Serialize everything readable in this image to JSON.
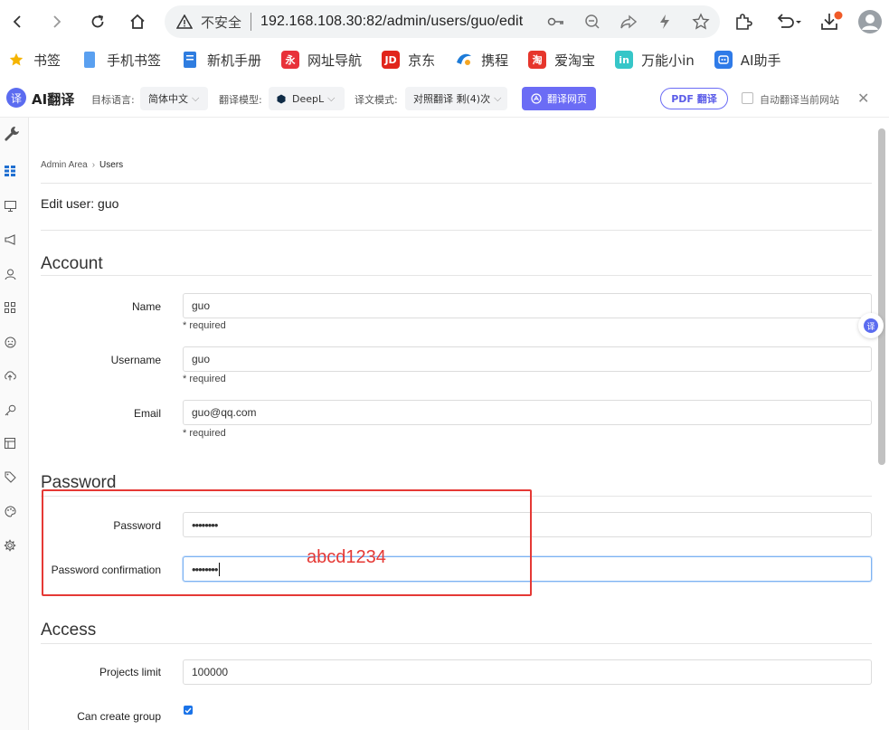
{
  "browser": {
    "insecure_label": "不安全",
    "url": "192.168.108.30:82/admin/users/guo/edit"
  },
  "bookmarks": [
    {
      "label": "书签",
      "icon": "star-icon",
      "color": "#f5b400"
    },
    {
      "label": "手机书签",
      "icon": "phone-icon",
      "color": "#5aa0f0"
    },
    {
      "label": "新机手册",
      "icon": "book-icon",
      "color": "#2f7de0"
    },
    {
      "label": "网址导航",
      "icon": "nav-icon",
      "color": "#e8323a"
    },
    {
      "label": "京东",
      "icon": "jd-icon",
      "color": "#e1251b"
    },
    {
      "label": "携程",
      "icon": "ctrip-icon",
      "color": "#1d7bd8"
    },
    {
      "label": "爱淘宝",
      "icon": "taobao-icon",
      "color": "#e6362c"
    },
    {
      "label": "万能小in",
      "icon": "in-icon",
      "color": "#36c6c8"
    },
    {
      "label": "AI助手",
      "icon": "ai-icon",
      "color": "#2f7be8"
    }
  ],
  "translate_bar": {
    "logo_char": "译",
    "title": "AI翻译",
    "target_lang_label": "目标语言:",
    "target_lang_value": "简体中文",
    "model_label": "翻译模型:",
    "model_value": "DeepL",
    "mode_label": "译文模式:",
    "mode_value": "对照翻译 剩(4)次",
    "translate_button": "翻译网页",
    "pdf_button": "PDF 翻译",
    "auto_label": "自动翻译当前网站"
  },
  "breadcrumb": {
    "root": "Admin Area",
    "current": "Users"
  },
  "page_title": "Edit user: guo",
  "sections": {
    "account": "Account",
    "password": "Password",
    "access": "Access"
  },
  "fields": {
    "name": {
      "label": "Name",
      "value": "guo",
      "hint": "* required"
    },
    "username": {
      "label": "Username",
      "value": "guo",
      "hint": "* required"
    },
    "email": {
      "label": "Email",
      "value": "guo@qq.com",
      "hint": "* required"
    },
    "password": {
      "label": "Password",
      "value": "••••••••"
    },
    "password_confirmation": {
      "label": "Password confirmation",
      "value": "••••••••"
    },
    "projects_limit": {
      "label": "Projects limit",
      "value": "100000"
    },
    "can_create_group": {
      "label": "Can create group",
      "checked": true
    }
  },
  "annotation": "abcd1234",
  "colors": {
    "annotation_red": "#e53935",
    "translate_purple": "#6b6cf5",
    "focus_blue": "#7db3f2"
  }
}
